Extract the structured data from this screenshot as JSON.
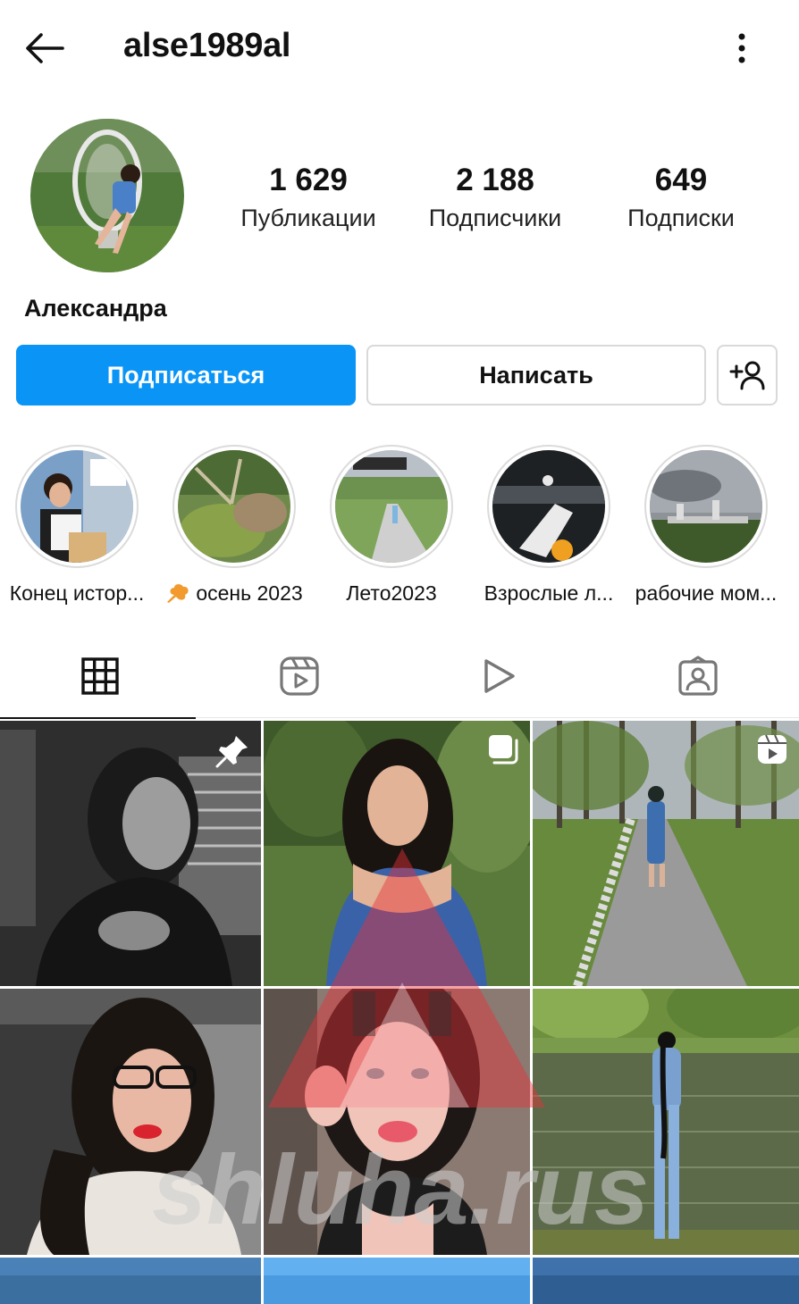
{
  "header": {
    "username": "alse1989al",
    "back_icon": "arrow-left-icon",
    "more_icon": "more-vertical-icon"
  },
  "profile": {
    "full_name": "Александра",
    "stats": [
      {
        "value": "1 629",
        "label": "Публикации"
      },
      {
        "value": "2 188",
        "label": "Подписчики"
      },
      {
        "value": "649",
        "label": "Подписки"
      }
    ]
  },
  "actions": {
    "follow_label": "Подписаться",
    "message_label": "Написать",
    "add_user_icon": "add-user-icon",
    "accent_color": "#0a95f6"
  },
  "highlights": [
    {
      "label": "Конец истор..."
    },
    {
      "label": "осень 2023",
      "emoji_icon": "maple-leaf-icon"
    },
    {
      "label": "Лето2023"
    },
    {
      "label": "Взрослые л..."
    },
    {
      "label": "рабочие мом..."
    }
  ],
  "tabs": [
    {
      "name": "grid",
      "icon": "grid-icon",
      "active": true
    },
    {
      "name": "reels",
      "icon": "reels-icon",
      "active": false
    },
    {
      "name": "videos",
      "icon": "play-icon",
      "active": false
    },
    {
      "name": "tagged",
      "icon": "tagged-user-icon",
      "active": false
    }
  ],
  "posts": [
    {
      "badge": "pin-icon"
    },
    {
      "badge": "carousel-icon"
    },
    {
      "badge": "reel-icon"
    },
    {
      "badge": ""
    },
    {
      "badge": ""
    },
    {
      "badge": ""
    }
  ],
  "watermark": {
    "text": "shluha.rus"
  }
}
